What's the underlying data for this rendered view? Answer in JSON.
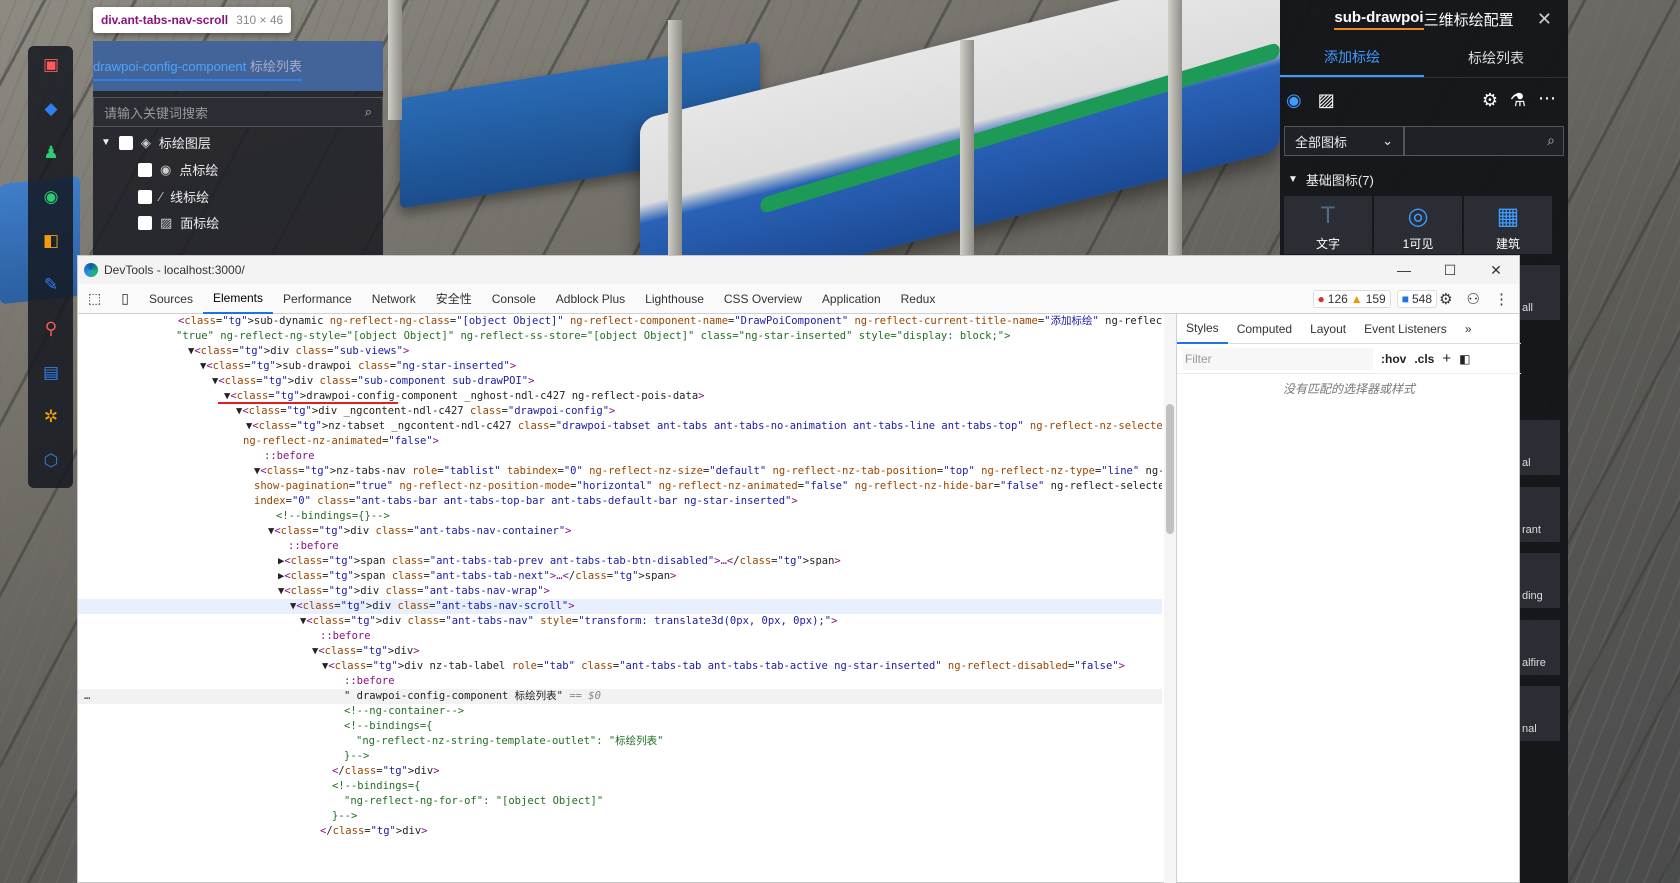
{
  "tooltip": {
    "selector": "div.ant-tabs-nav-scroll",
    "size": "310 × 46"
  },
  "tree_panel": {
    "tab_tag": "drawpoi-config-component",
    "tab_label": "标绘列表",
    "search_placeholder": "请输入关键词搜索",
    "root": "标绘图层",
    "items": [
      "点标绘",
      "线标绘",
      "面标绘"
    ]
  },
  "right_panel": {
    "title_bold": "sub-drawpoi",
    "title_rest": " 三维标绘配置",
    "close": "✕",
    "tabs": [
      "添加标绘",
      "标绘列表"
    ],
    "select_value": "全部图标",
    "group": "基础图标(7)",
    "icons": [
      {
        "label": "文字",
        "icon": "text-icon"
      },
      {
        "label": "1可见",
        "icon": "eye-icon"
      },
      {
        "label": "建筑",
        "icon": "building-icon"
      }
    ],
    "peek_labels": [
      "all",
      "al",
      "rant",
      "ding",
      "alfire",
      "nal"
    ]
  },
  "devtools": {
    "title": "DevTools - localhost:3000/",
    "tabs": [
      "Sources",
      "Elements",
      "Performance",
      "Network",
      "安全性",
      "Console",
      "Adblock Plus",
      "Lighthouse",
      "CSS Overview",
      "Application",
      "Redux"
    ],
    "active_tab": "Elements",
    "errors": "126",
    "warnings": "159",
    "messages": "548",
    "styles_tabs": [
      "Styles",
      "Computed",
      "Layout",
      "Event Listeners",
      "»"
    ],
    "filter_placeholder": "Filter",
    "hov": ":hov",
    "cls": ".cls",
    "no_match": "没有匹配的选择器或样式",
    "dom_lines": [
      "<sub-dynamic ng-reflect-ng-class=\"[object Object]\" ng-reflect-component-name=\"DrawPoiComponent\" ng-reflect-current-title-name=\"添加标绘\" ng-reflect-ss-visible=",
      "\"true\" ng-reflect-ng-style=\"[object Object]\" ng-reflect-ss-store=\"[object Object]\" class=\"ng-star-inserted\" style=\"display: block;\">",
      "▼<div class=\"sub-views\">",
      "▼<sub-drawpoi class=\"ng-star-inserted\">",
      "▼<div class=\"sub-component sub-drawPOI\">",
      "▼<drawpoi-config-component _nghost-ndl-c427 ng-reflect-pois-data>",
      "▼<div _ngcontent-ndl-c427 class=\"drawpoi-config\">",
      "▼<nz-tabset _ngcontent-ndl-c427 class=\"drawpoi-tabset ant-tabs ant-tabs-no-animation ant-tabs-line ant-tabs-top\" ng-reflect-nz-selected-index=\"1\"",
      "ng-reflect-nz-animated=\"false\">",
      "::before",
      "▼<nz-tabs-nav role=\"tablist\" tabindex=\"0\" ng-reflect-nz-size=\"default\" ng-reflect-nz-tab-position=\"top\" ng-reflect-nz-type=\"line\" ng-reflect-nz-",
      "show-pagination=\"true\" ng-reflect-nz-position-mode=\"horizontal\" ng-reflect-nz-animated=\"false\" ng-reflect-nz-hide-bar=\"false\" ng-reflect-selected-",
      "index=\"0\" class=\"ant-tabs-bar ant-tabs-top-bar ant-tabs-default-bar ng-star-inserted\">",
      "<!--bindings={}-->",
      "▼<div class=\"ant-tabs-nav-container\">",
      "::before",
      "▶<span class=\"ant-tabs-tab-prev ant-tabs-tab-btn-disabled\">…</span>",
      "▶<span class=\"ant-tabs-tab-next\">…</span>",
      "▼<div class=\"ant-tabs-nav-wrap\">",
      "▼<div class=\"ant-tabs-nav-scroll\">",
      "▼<div class=\"ant-tabs-nav\" style=\"transform: translate3d(0px, 0px, 0px);\">",
      "::before",
      "▼<div>",
      "▼<div nz-tab-label role=\"tab\" class=\"ant-tabs-tab ant-tabs-tab-active ng-star-inserted\" ng-reflect-disabled=\"false\">",
      "::before",
      "\" drawpoi-config-component 标绘列表\" == $0",
      "<!--ng-container-->",
      "<!--bindings={",
      "\"ng-reflect-nz-string-template-outlet\": \"标绘列表\"",
      "}-->",
      "</div>",
      "<!--bindings={",
      "\"ng-reflect-ng-for-of\": \"[object Object]\"",
      "}-->",
      "</div>"
    ]
  }
}
